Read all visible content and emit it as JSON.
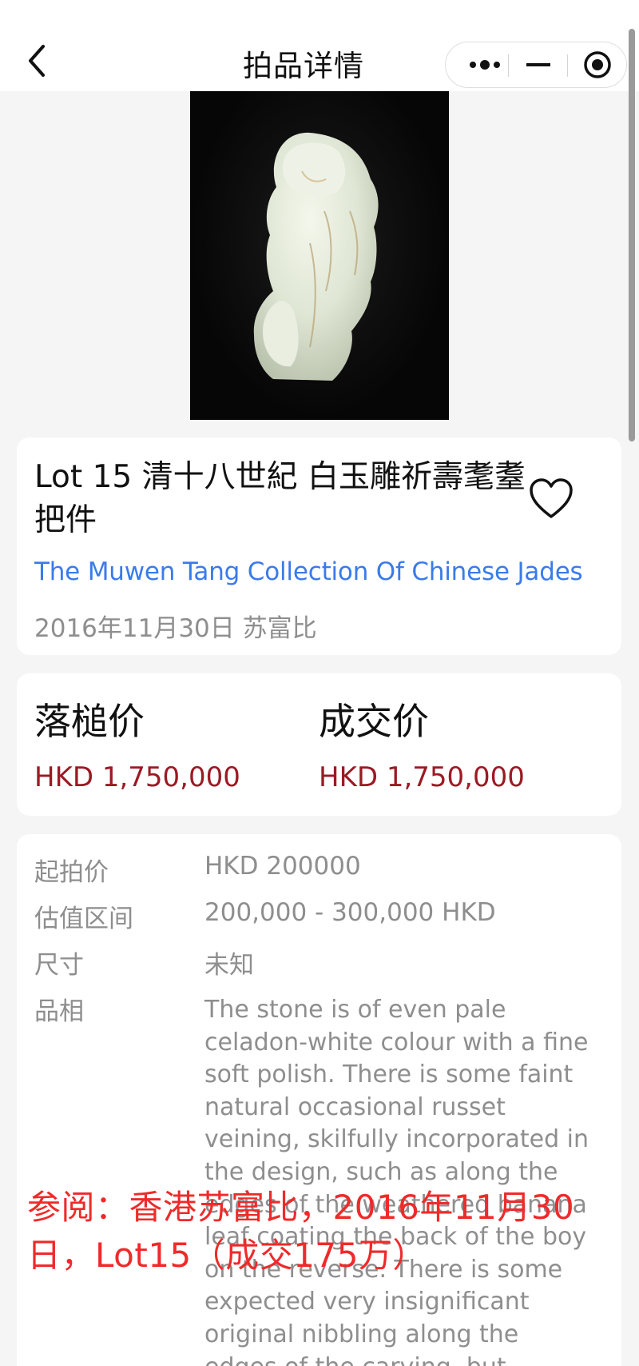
{
  "nav": {
    "title": "拍品详情"
  },
  "icons": {
    "back": "chevron-left-icon",
    "more": "more-dots-icon",
    "minimize": "minimize-icon",
    "close": "target-close-icon",
    "favorite": "heart-outline-icon"
  },
  "lot": {
    "title": "Lot 15 清十八世紀 白玉雕祈壽耄耋把件",
    "collection": "The Muwen Tang Collection Of Chinese Jades",
    "sale_info": "2016年11月30日 苏富比"
  },
  "prices": {
    "hammer_label": "落槌价",
    "hammer_value": "HKD 1,750,000",
    "deal_label": "成交价",
    "deal_value": "HKD 1,750,000"
  },
  "details": {
    "start_label": "起拍价",
    "start_value": "HKD 200000",
    "estimate_label": "估值区间",
    "estimate_value": "200,000 - 300,000 HKD",
    "size_label": "尺寸",
    "size_value": "未知",
    "condition_label": "品相",
    "condition_text": "The stone is of even pale celadon-white colour with a fine soft polish. There is some faint natural occasional russet veining, skilfully incorporated in the design, such as along the edges of the weathered banana leaf coating the back of the boy on the reverse. There is some expected very insignificant original nibbling along the edges of the carving, but"
  },
  "overlay": {
    "note": "参阅：香港苏富比，2016年11月30日，Lot15（成交175万）"
  },
  "colors": {
    "link": "#3a7bea",
    "price": "#9b1a24",
    "overlay": "#ef2a2a"
  }
}
